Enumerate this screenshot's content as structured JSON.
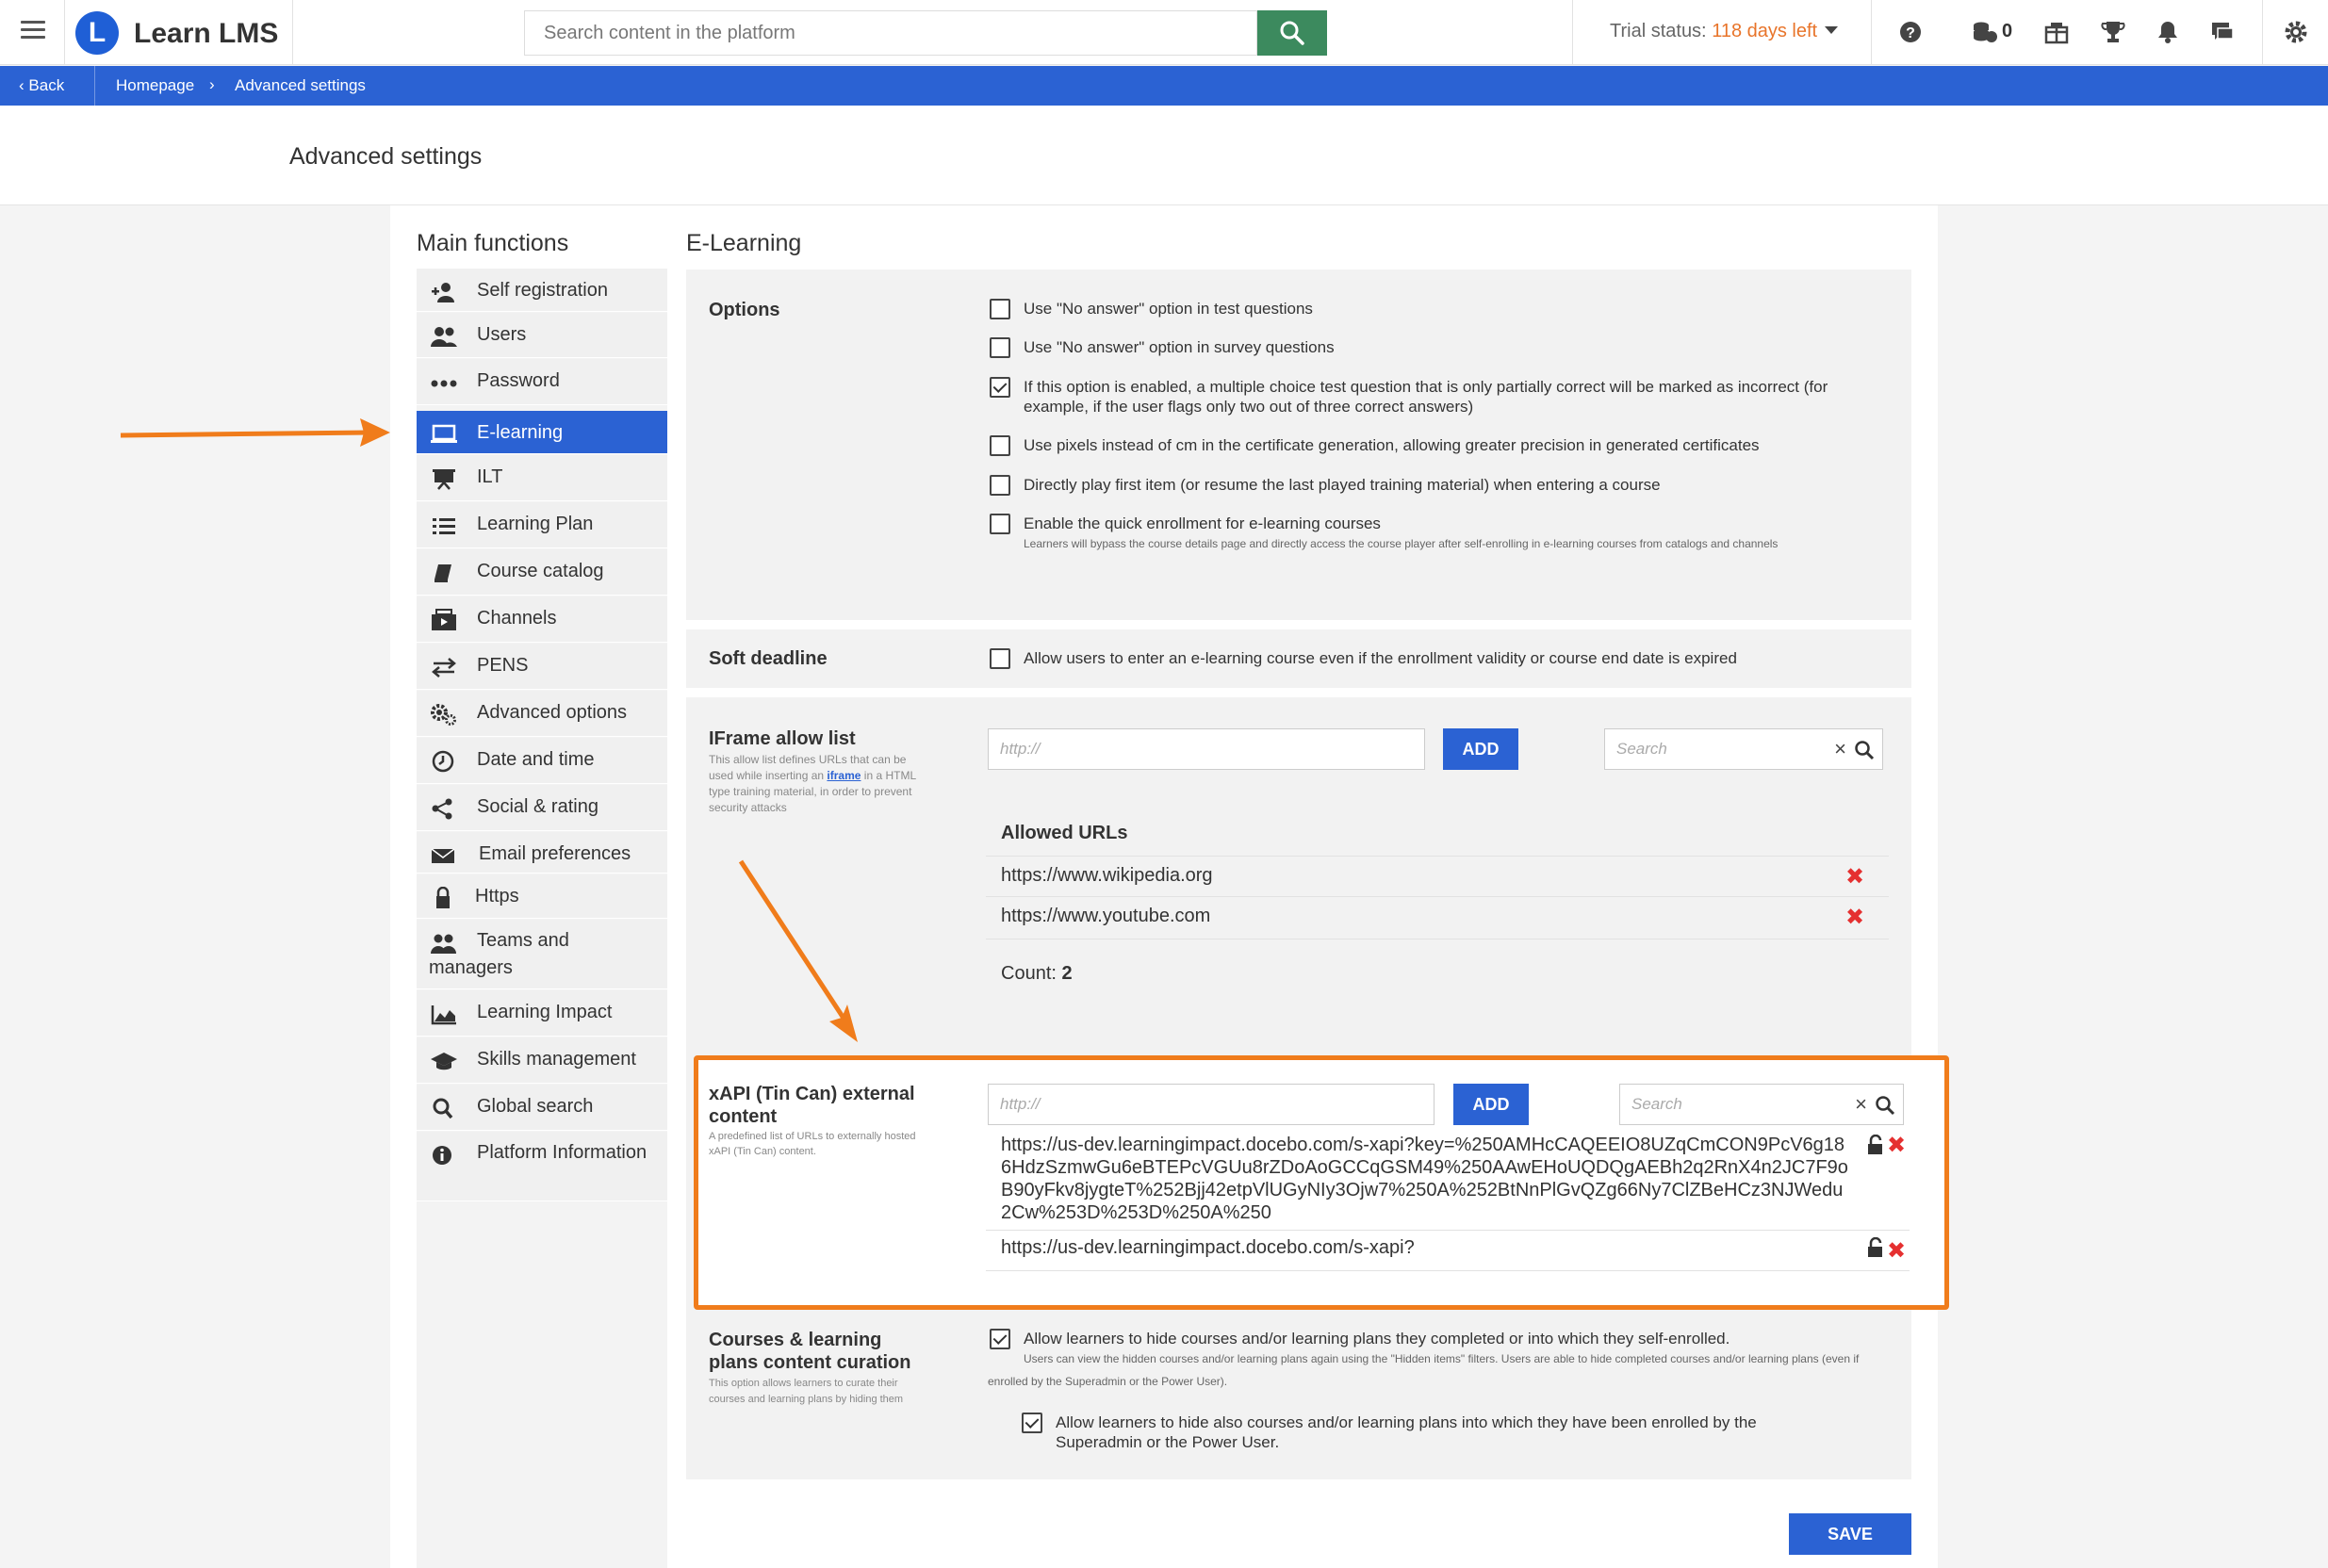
{
  "app": {
    "name": "Learn LMS",
    "logo_letter": "L"
  },
  "topbar": {
    "search_placeholder": "Search content in the platform",
    "trial_label": "Trial status:",
    "trial_days": "118 days left",
    "coins_count": "0"
  },
  "breadcrumb": {
    "back": "Back",
    "home": "Homepage",
    "current": "Advanced settings"
  },
  "page": {
    "title": "Advanced settings"
  },
  "sidebar": {
    "title": "Main functions",
    "items": [
      {
        "label": "Self registration",
        "icon": "add-user-icon"
      },
      {
        "label": "Users",
        "icon": "users-icon"
      },
      {
        "label": "Password",
        "icon": "dots-icon"
      },
      {
        "label": "E-learning",
        "icon": "laptop-icon",
        "active": true
      },
      {
        "label": "ILT",
        "icon": "presentation-icon"
      },
      {
        "label": "Learning Plan",
        "icon": "list-icon"
      },
      {
        "label": "Course catalog",
        "icon": "book-icon"
      },
      {
        "label": "Channels",
        "icon": "channels-icon"
      },
      {
        "label": "PENS",
        "icon": "exchange-icon"
      },
      {
        "label": "Advanced options",
        "icon": "gears-icon"
      },
      {
        "label": "Date and time",
        "icon": "clock-icon"
      },
      {
        "label": "Social & rating",
        "icon": "share-icon"
      },
      {
        "label": "Email preferences",
        "icon": "envelope-icon"
      },
      {
        "label": "Https",
        "icon": "lock-icon"
      },
      {
        "label": "Teams and managers",
        "icon": "team-icon"
      },
      {
        "label": "Learning Impact",
        "icon": "chart-icon"
      },
      {
        "label": "Skills management",
        "icon": "graduation-cap-icon"
      },
      {
        "label": "Global search",
        "icon": "search-icon"
      },
      {
        "label": "Platform Information",
        "icon": "info-icon"
      }
    ]
  },
  "content": {
    "title": "E-Learning",
    "options": {
      "label": "Options",
      "items": [
        {
          "text": "Use \"No answer\" option in test questions",
          "checked": false
        },
        {
          "text": "Use \"No answer\" option in survey questions",
          "checked": false
        },
        {
          "text": "If this option is enabled, a multiple choice test question that is only partially correct will be marked as incorrect (for example, if the user flags only two out of three correct answers)",
          "checked": true
        },
        {
          "text": "Use pixels instead of cm in the certificate generation, allowing greater precision in generated certificates",
          "checked": false
        },
        {
          "text": "Directly play first item (or resume the last played training material) when entering a course",
          "checked": false
        },
        {
          "text": "Enable the quick enrollment for e-learning courses",
          "checked": false,
          "sub": "Learners will bypass the course details page and directly access the course player after self-enrolling in e-learning courses from catalogs and channels"
        }
      ]
    },
    "soft_deadline": {
      "label": "Soft deadline",
      "text": "Allow users to enter an e-learning course even if the enrollment validity or course end date is expired",
      "checked": false
    },
    "iframe": {
      "label": "IFrame allow list",
      "desc_before": "This allow list defines URLs that can be used while inserting an",
      "desc_link": "iframe",
      "desc_after": "in a HTML type training material, in order to prevent security attacks",
      "input_placeholder": "http://",
      "add_label": "ADD",
      "search_placeholder": "Search",
      "list_title": "Allowed URLs",
      "urls": [
        "https://www.wikipedia.org",
        "https://www.youtube.com"
      ],
      "count_label": "Count:",
      "count_value": "2"
    },
    "xapi": {
      "label": "xAPI (Tin Can) external content",
      "desc": "A predefined list of URLs to externally hosted xAPI (Tin Can) content.",
      "input_placeholder": "http://",
      "add_label": "ADD",
      "search_placeholder": "Search",
      "urls": [
        "https://us-dev.learningimpact.docebo.com/s-xapi?key=%250AMHcCAQEEIO8UZqCmCON9PcV6g186HdzSzmwGu6eBTEPcVGUu8rZDoAoGCCqGSM49%250AAwEHoUQDQgAEBh2q2RnX4n2JC7F9oB90yFkv8jygteT%252Bjj42etpVlUGyNIy3Ojw7%250A%252BtNnPlGvQZg66Ny7ClZBeHCz3NJWedu2Cw%253D%253D%250A%250",
        "https://us-dev.learningimpact.docebo.com/s-xapi?"
      ]
    },
    "curation": {
      "label": "Courses & learning plans content curation",
      "desc": "This option allows learners to curate their courses and learning plans by hiding them",
      "opt1": "Allow learners to hide courses and/or learning plans they completed or into which they self-enrolled.",
      "opt1_sub": "Users can view the hidden courses and/or learning plans again using the \"Hidden items\" filters. Users are able to hide completed courses and/or learning plans (even if enrolled by the Superadmin or the Power User).",
      "opt2": "Allow learners to hide also courses and/or learning plans into which they have been enrolled by the Superadmin or the Power User.",
      "opt1_checked": true,
      "opt2_checked": true
    },
    "save_label": "SAVE"
  },
  "colors": {
    "accent": "#2b62d3",
    "annotation": "#f07c1b",
    "delete": "#e53030",
    "trial": "#e8742a"
  }
}
